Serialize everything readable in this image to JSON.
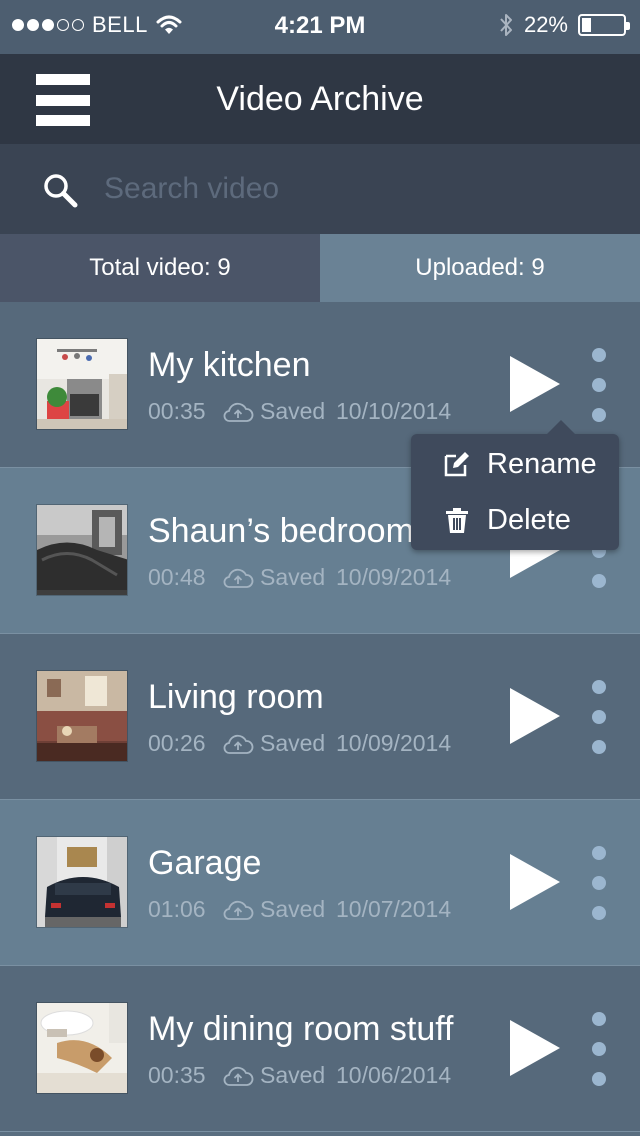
{
  "status_bar": {
    "carrier": "BELL",
    "time": "4:21 PM",
    "battery_percent": "22%",
    "battery_level": 0.22,
    "signal_bars_filled": 3,
    "signal_bars_total": 5
  },
  "header": {
    "title": "Video Archive",
    "menu_icon": "hamburger-icon"
  },
  "search": {
    "placeholder": "Search video",
    "value": "",
    "icon": "search-icon"
  },
  "tabs": {
    "total_label": "Total video: 9",
    "uploaded_label": "Uploaded: 9"
  },
  "videos": [
    {
      "title": "My kitchen",
      "duration": "00:35",
      "status": "Saved",
      "date": "10/10/2014",
      "thumb": "kitchen"
    },
    {
      "title": "Shaun’s bedroom",
      "duration": "00:48",
      "status": "Saved",
      "date": "10/09/2014",
      "thumb": "bedroom"
    },
    {
      "title": "Living room",
      "duration": "00:26",
      "status": "Saved",
      "date": "10/09/2014",
      "thumb": "living"
    },
    {
      "title": "Garage",
      "duration": "01:06",
      "status": "Saved",
      "date": "10/07/2014",
      "thumb": "garage"
    },
    {
      "title": "My dining room stuff",
      "duration": "00:35",
      "status": "Saved",
      "date": "10/06/2014",
      "thumb": "dining"
    }
  ],
  "context_menu": {
    "rename_label": "Rename",
    "delete_label": "Delete",
    "rename_icon": "edit-icon",
    "delete_icon": "trash-icon"
  },
  "colors": {
    "header_bg": "#2f3744",
    "search_bg": "#3a4453",
    "tab_active_bg": "#4b5568",
    "tab_inactive_bg": "#6a8295",
    "row_dark": "#56697b",
    "row_light": "#667f92",
    "accent_dot": "#9bb6cf"
  }
}
